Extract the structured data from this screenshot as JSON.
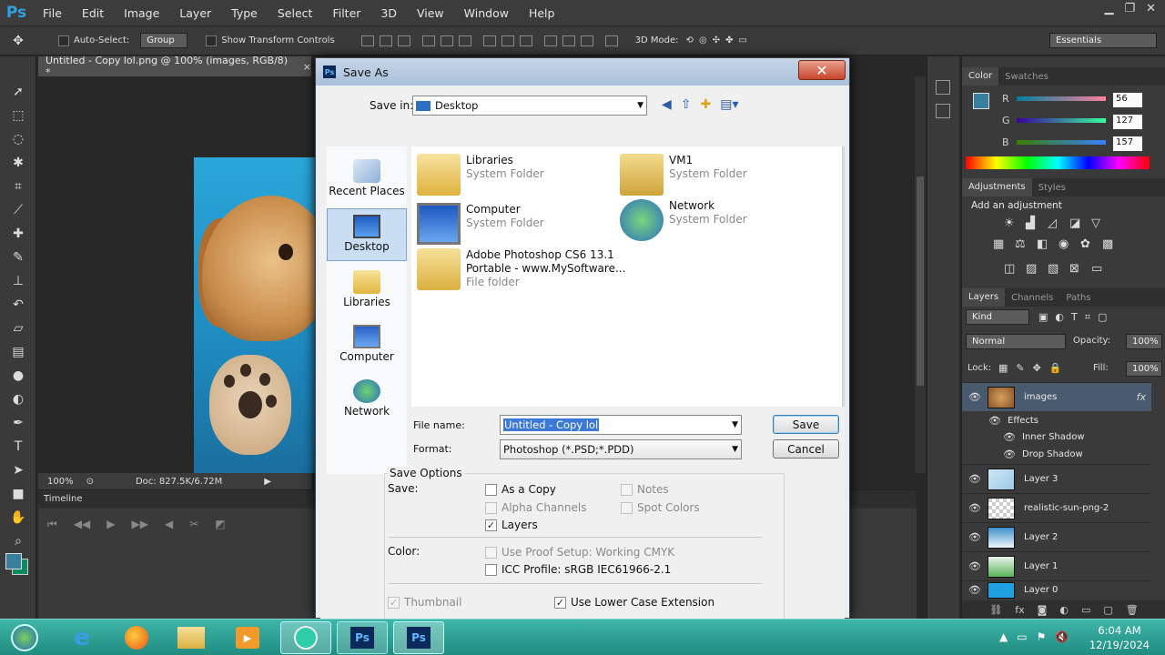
{
  "app": {
    "logo": "Ps"
  },
  "menu": [
    "File",
    "Edit",
    "Image",
    "Layer",
    "Type",
    "Select",
    "Filter",
    "3D",
    "View",
    "Window",
    "Help"
  ],
  "options": {
    "auto_select": "Auto-Select:",
    "group": "Group",
    "show_transform": "Show Transform Controls",
    "mode_3d": "3D Mode:",
    "workspace": "Essentials"
  },
  "document": {
    "tab": "Untitled - Copy lol.png @ 100% (images, RGB/8) *",
    "close": "×",
    "zoom": "100%",
    "doc_size": "Doc: 827.5K/6.72M"
  },
  "timeline": {
    "label": "Timeline"
  },
  "color_panel": {
    "tabs": [
      "Color",
      "Swatches"
    ],
    "r_label": "R",
    "g_label": "G",
    "b_label": "B",
    "r": "56",
    "g": "127",
    "b": "157",
    "fg_color": "#387f9d"
  },
  "adjustments": {
    "tabs": [
      "Adjustments",
      "Styles"
    ],
    "heading": "Add an adjustment"
  },
  "layers_panel": {
    "tabs": [
      "Layers",
      "Channels",
      "Paths"
    ],
    "kind": "Kind",
    "blend": "Normal",
    "opacity_label": "Opacity:",
    "opacity": "100%",
    "lock_label": "Lock:",
    "fill_label": "Fill:",
    "fill": "100%",
    "layers": [
      "images",
      "Layer 3",
      "realistic-sun-png-2",
      "Layer 2",
      "Layer 1",
      "Layer 0"
    ],
    "effects_label": "Effects",
    "effects": [
      "Inner Shadow",
      "Drop Shadow"
    ],
    "fx": "fx"
  },
  "dialog": {
    "title": "Save As",
    "save_in_label": "Save in:",
    "save_in": "Desktop",
    "places": [
      "Recent Places",
      "Desktop",
      "Libraries",
      "Computer",
      "Network"
    ],
    "files": [
      {
        "name": "Libraries",
        "type": "System Folder"
      },
      {
        "name": "VM1",
        "type": "System Folder"
      },
      {
        "name": "Computer",
        "type": "System Folder"
      },
      {
        "name": "Network",
        "type": "System Folder"
      },
      {
        "name": "Adobe Photoshop CS6 13.1",
        "name2": "Portable - www.MySoftware...",
        "type": "File folder"
      }
    ],
    "file_name_label": "File name:",
    "file_name": "Untitled - Copy lol",
    "format_label": "Format:",
    "format": "Photoshop (*.PSD;*.PDD)",
    "save": "Save",
    "cancel": "Cancel",
    "save_options": "Save Options",
    "save_label": "Save:",
    "as_copy": "As a Copy",
    "notes": "Notes",
    "alpha": "Alpha Channels",
    "spot": "Spot Colors",
    "layers": "Layers",
    "color_label": "Color:",
    "proof_setup": "Use Proof Setup:  Working CMYK",
    "icc_profile": "ICC Profile:  sRGB IEC61966-2.1",
    "thumbnail": "Thumbnail",
    "lower_case": "Use Lower Case Extension"
  },
  "taskbar": {
    "time": "6:04 AM",
    "date": "12/19/2024"
  }
}
